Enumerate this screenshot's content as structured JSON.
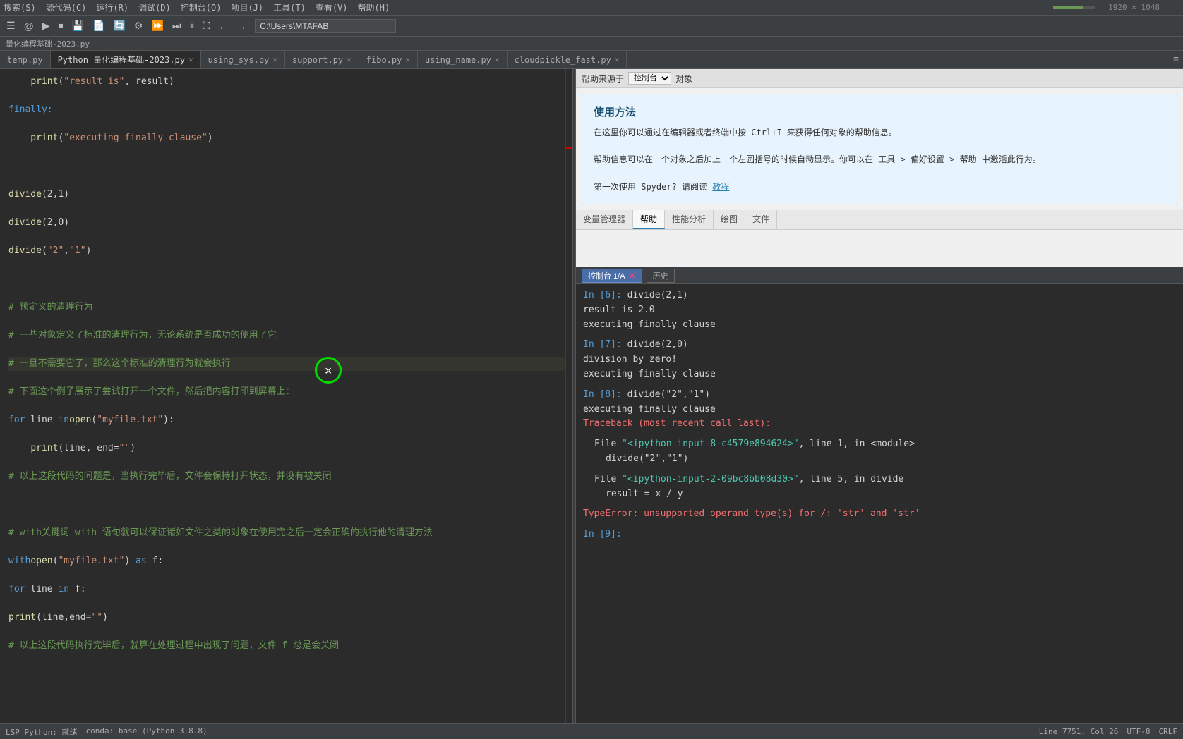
{
  "menubar": {
    "items": [
      "搜索(S)",
      "源代码(C)",
      "运行(R)",
      "调试(D)",
      "控制台(O)",
      "项目(J)",
      "工具(T)",
      "查看(V)",
      "帮助(H)"
    ]
  },
  "toolbar": {
    "path": "C:\\Users\\MTAFAB"
  },
  "filepath": {
    "text": "量化编程基础-2023.py"
  },
  "tabs": [
    {
      "label": "temp.py",
      "active": false,
      "closable": false
    },
    {
      "label": "Python 量化编程基础-2023.py",
      "active": true,
      "closable": true,
      "modified": true
    },
    {
      "label": "using_sys.py",
      "active": false,
      "closable": true
    },
    {
      "label": "support.py",
      "active": false,
      "closable": true
    },
    {
      "label": "fibo.py",
      "active": false,
      "closable": true
    },
    {
      "label": "using_name.py",
      "active": false,
      "closable": true
    },
    {
      "label": "cloudpickle_fast.py",
      "active": false,
      "closable": true
    }
  ],
  "editor": {
    "lines": [
      "    print(\"result is\", result)",
      "",
      "finally:",
      "",
      "    print(\"executing finally clause\")",
      "",
      "",
      "",
      "divide(2,1)",
      "",
      "divide(2,0)",
      "",
      "divide(\"2\",\"1\")",
      "",
      "",
      "",
      "# 预定义的清理行为",
      "",
      "# 一些对象定义了标准的清理行为，无论系统是否成功的使用了它",
      "",
      "# 一旦不需要它了，那么这个标准的清理行为就会执行",
      "",
      "# 下面这个例子展示了尝试打开一个文件，然后把内容打印到屏幕上：",
      "",
      "for line in open(\"myfile.txt\"):",
      "",
      "    print(line, end=\"\")",
      "",
      "# 以上这段代码的问题是，当执行完毕后，文件会保持打开状态，并没有被关闭",
      "",
      "",
      "",
      "# with关键词 with 语句就可以保证诸如文件之类的对象在使用完之后一定会正确的执行他的清理方法",
      "",
      "with open(\"myfile.txt\") as f:",
      "",
      "    for line in f:",
      "",
      "        print(line,end=\"\")",
      "",
      "# 以上这段代码执行完毕后，就算在处理过程中出现了问题，文件 f 总是会关闭"
    ]
  },
  "help": {
    "source_label": "帮助来源于",
    "source_options": [
      "控制台"
    ],
    "object_label": "对象",
    "card_title": "使用方法",
    "card_body_line1": "在这里你可以通过在编辑器或者终端中按 Ctrl+I 来获得任何对象的帮助信息。",
    "card_body_line2": "帮助信息可以在一个对象之后加上一个左圆括号的时候自动显示。你可以在 工具 > 偏好设置 > 帮助 中激活此行为。",
    "card_footer": "第一次使用 Spyder? 请阅读",
    "card_link": "教程",
    "tabs": [
      "变量管理器",
      "帮助",
      "性能分析",
      "绘图",
      "文件"
    ]
  },
  "console": {
    "title": "控制台 1/A",
    "history_btn": "历史",
    "entries": [
      {
        "type": "in",
        "prompt": "In [6]:",
        "code": " divide(2,1)"
      },
      {
        "type": "out",
        "text": "result is 2.0"
      },
      {
        "type": "out",
        "text": "executing finally clause"
      },
      {
        "type": "divider"
      },
      {
        "type": "in",
        "prompt": "In [7]:",
        "code": " divide(2,0)"
      },
      {
        "type": "out",
        "text": "division by zero!"
      },
      {
        "type": "out",
        "text": "executing finally clause"
      },
      {
        "type": "divider"
      },
      {
        "type": "in",
        "prompt": "In [8]:",
        "code": " divide(\"2\",\"1\")"
      },
      {
        "type": "out",
        "text": "executing finally clause"
      },
      {
        "type": "error",
        "text": "Traceback (most recent call last):"
      },
      {
        "type": "divider"
      },
      {
        "type": "error_detail",
        "indent": "  File ",
        "link": "\"<ipython-input-8-c4579e894624>\"",
        "rest": ", line 1, in <module>"
      },
      {
        "type": "error_code",
        "text": "    divide(\"2\",\"1\")"
      },
      {
        "type": "divider"
      },
      {
        "type": "error_detail",
        "indent": "  File ",
        "link": "\"<ipython-input-2-09bc8bb08d30>\"",
        "rest": ", line 5, in divide"
      },
      {
        "type": "error_code",
        "text": "    result = x / y"
      },
      {
        "type": "divider"
      },
      {
        "type": "error",
        "text": "TypeError: unsupported operand type(s) for /: 'str' and 'str'"
      },
      {
        "type": "divider"
      },
      {
        "type": "in",
        "prompt": "In [9]:",
        "code": ""
      }
    ]
  },
  "statusbar": {
    "left": {
      "lsp": "LSP Python: 就绪",
      "conda": "conda: base (Python 3.8.8)"
    },
    "right": {
      "position": "Line 7751, Col 26",
      "encoding": "UTF-8",
      "eol": "CRLF"
    }
  }
}
